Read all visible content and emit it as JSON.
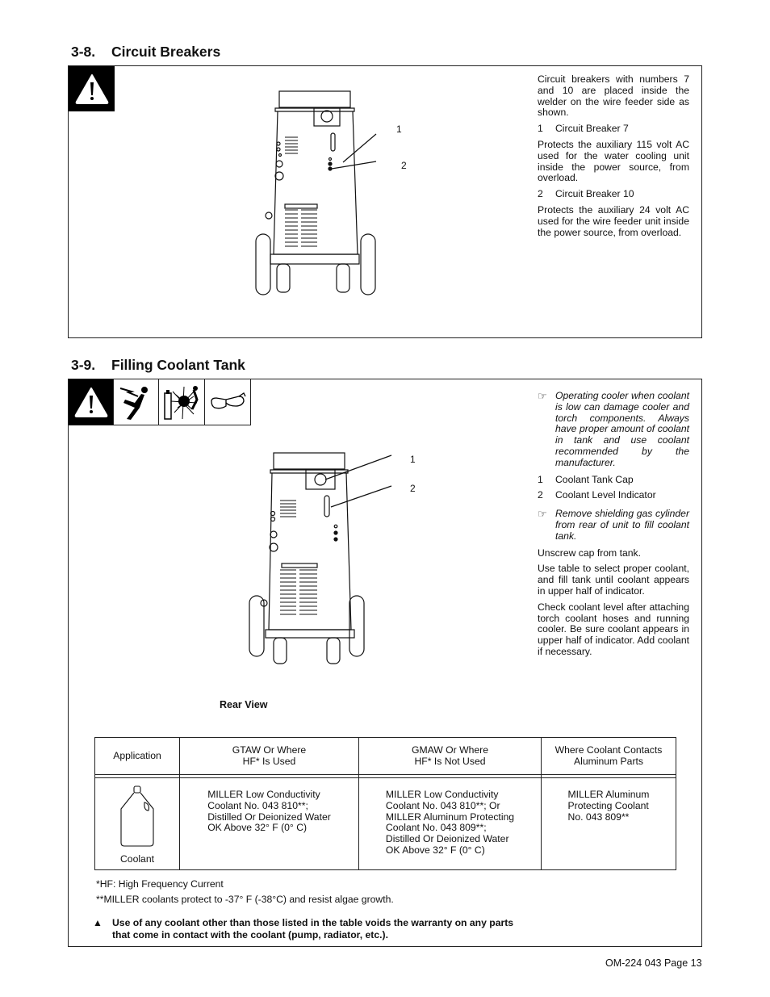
{
  "section_3_8": {
    "number": "3-8.",
    "title": "Circuit Breakers",
    "icons": [
      "warning-icon"
    ],
    "callouts": [
      "1",
      "2"
    ],
    "intro": "Circuit breakers with numbers 7 and 10 are placed inside the welder on the wire feeder side as shown.",
    "items": [
      {
        "num": "1",
        "label": "Circuit Breaker 7",
        "desc": "Protects the auxiliary 115 volt AC used for the water cooling unit inside the power source, from overload."
      },
      {
        "num": "2",
        "label": "Circuit Breaker 10",
        "desc": "Protects the auxiliary 24 volt AC used for the wire feeder unit inside the power source, from overload."
      }
    ]
  },
  "section_3_9": {
    "number": "3-9.",
    "title": "Filling Coolant Tank",
    "icons": [
      "warning-icon",
      "electric-shock-icon",
      "cylinder-explosion-icon",
      "safety-glasses-icon"
    ],
    "callouts": [
      "1",
      "2"
    ],
    "figure_caption": "Rear View",
    "note1": "Operating cooler when coolant is low can damage cooler and torch components. Always have proper amount of coolant in tank and use coolant recommended by the manufacturer.",
    "items": [
      {
        "num": "1",
        "label": "Coolant Tank Cap"
      },
      {
        "num": "2",
        "label": "Coolant Level Indicator"
      }
    ],
    "note2": "Remove shielding gas cylinder from rear of unit to fill coolant tank.",
    "paragraphs": [
      "Unscrew cap from tank.",
      "Use table to select proper coolant, and fill tank until coolant appears in upper half of indicator.",
      "Check coolant level after attaching torch coolant hoses and running cooler. Be sure coolant appears in upper half of indicator. Add coolant if necessary."
    ],
    "table": {
      "headers": [
        "Application",
        "GTAW Or Where\nHF* Is Used",
        "GMAW Or Where\nHF* Is Not Used",
        "Where Coolant Contacts\nAluminum Parts"
      ],
      "row_label": "Coolant",
      "cells": [
        [
          "MILLER Low Conductivity",
          "Coolant No. 043 810**;",
          "Distilled Or Deionized Water",
          "OK Above 32° F (0° C)"
        ],
        [
          "MILLER Low Conductivity",
          "Coolant No. 043 810**; Or",
          "MILLER Aluminum Protecting",
          "Coolant No. 043 809**;",
          "Distilled Or Deionized Water",
          "OK Above 32° F (0° C)"
        ],
        [
          "MILLER Aluminum",
          "Protecting Coolant",
          "No. 043 809**"
        ]
      ]
    },
    "footnotes": [
      "*HF: High Frequency Current",
      "**MILLER coolants protect to -37° F (-38°C) and resist algae growth."
    ],
    "warning_line1": "Use of any coolant other than those listed in the table voids the warranty on any parts",
    "warning_line2": "that come in contact with the coolant (pump, radiator, etc.)."
  },
  "footer": {
    "page_label": "OM-224 043 Page 13"
  }
}
